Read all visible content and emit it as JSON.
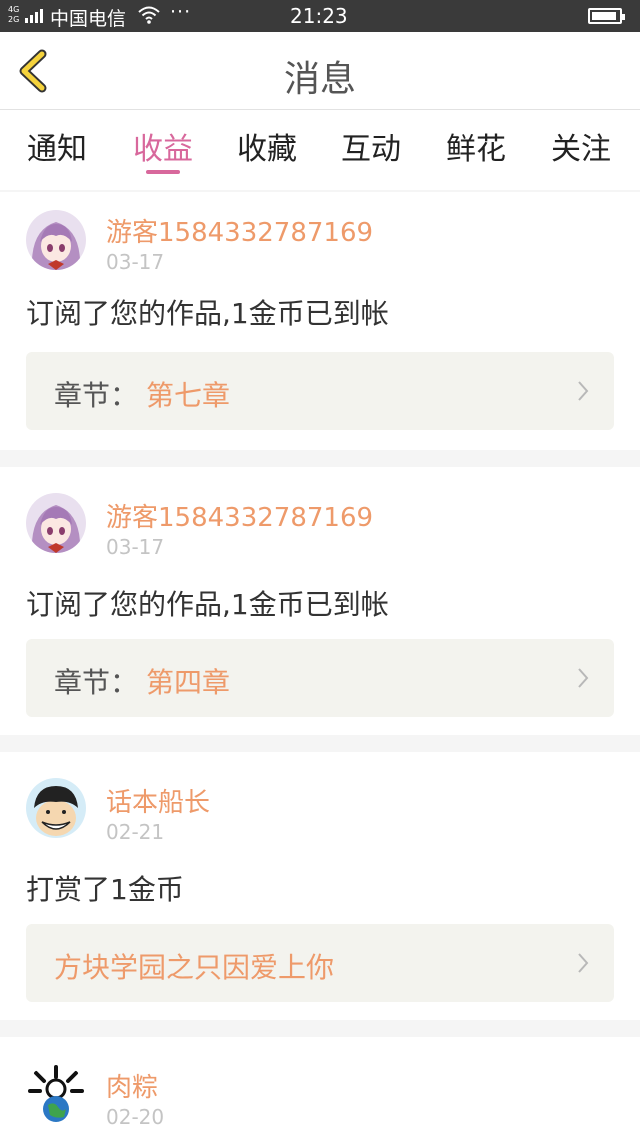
{
  "status_bar": {
    "network": "4G 2G",
    "carrier": "中国电信",
    "more": "···",
    "time": "21:23"
  },
  "nav": {
    "title": "消息"
  },
  "tabs": [
    {
      "label": "通知",
      "active": false
    },
    {
      "label": "收益",
      "active": true
    },
    {
      "label": "收藏",
      "active": false
    },
    {
      "label": "互动",
      "active": false
    },
    {
      "label": "鲜花",
      "active": false
    },
    {
      "label": "关注",
      "active": false
    }
  ],
  "colors": {
    "accent_pink": "#d8689c",
    "accent_orange": "#ee9a6a"
  },
  "messages": [
    {
      "user": "游客1584332787169",
      "date": "03-17",
      "text": "订阅了您的作品,1金币已到帐",
      "link_label": "章节：",
      "link_value": "第七章",
      "avatar": "anime-girl-avatar"
    },
    {
      "user": "游客1584332787169",
      "date": "03-17",
      "text": "订阅了您的作品,1金币已到帐",
      "link_label": "章节：",
      "link_value": "第四章",
      "avatar": "anime-girl-avatar"
    },
    {
      "user": "话本船长",
      "date": "02-21",
      "text": "打赏了1金币",
      "link_label": "",
      "link_value": "方块学园之只因爱上你",
      "avatar": "pirate-avatar"
    },
    {
      "user": "肉粽",
      "date": "02-20",
      "avatar": "globe-avatar"
    }
  ]
}
